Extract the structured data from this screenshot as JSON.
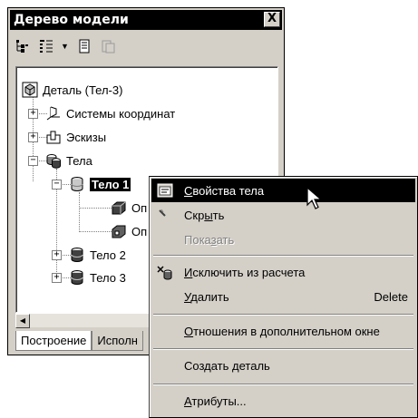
{
  "panel": {
    "title": "Дерево модели",
    "close_label": "X"
  },
  "tree": {
    "root": "Деталь (Тел-3)",
    "coords": "Системы координат",
    "sketches": "Эскизы",
    "bodies": "Тела",
    "body1": "Тело 1",
    "op1": "Оп",
    "op2": "Оп",
    "body2": "Тело 2",
    "body3": "Тело 3"
  },
  "tabs": {
    "build": "Построение",
    "exec": "Исполн"
  },
  "menu": {
    "props_u": "С",
    "props_rest": "войства тела",
    "hide_pre": "Скр",
    "hide_u": "ы",
    "hide_post": "ть",
    "show_pre": "Пока",
    "show_u": "з",
    "show_post": "ать",
    "exclude_u": "И",
    "exclude_rest": "сключить из расчета",
    "delete_u": "У",
    "delete_rest": "далить",
    "delete_shortcut": "Delete",
    "relations_u": "О",
    "relations_rest": "тношения в дополнительном окне",
    "create_pre": "Создать ",
    "create_u": "д",
    "create_post": "еталь",
    "attrs_u": "А",
    "attrs_rest": "трибуты..."
  }
}
